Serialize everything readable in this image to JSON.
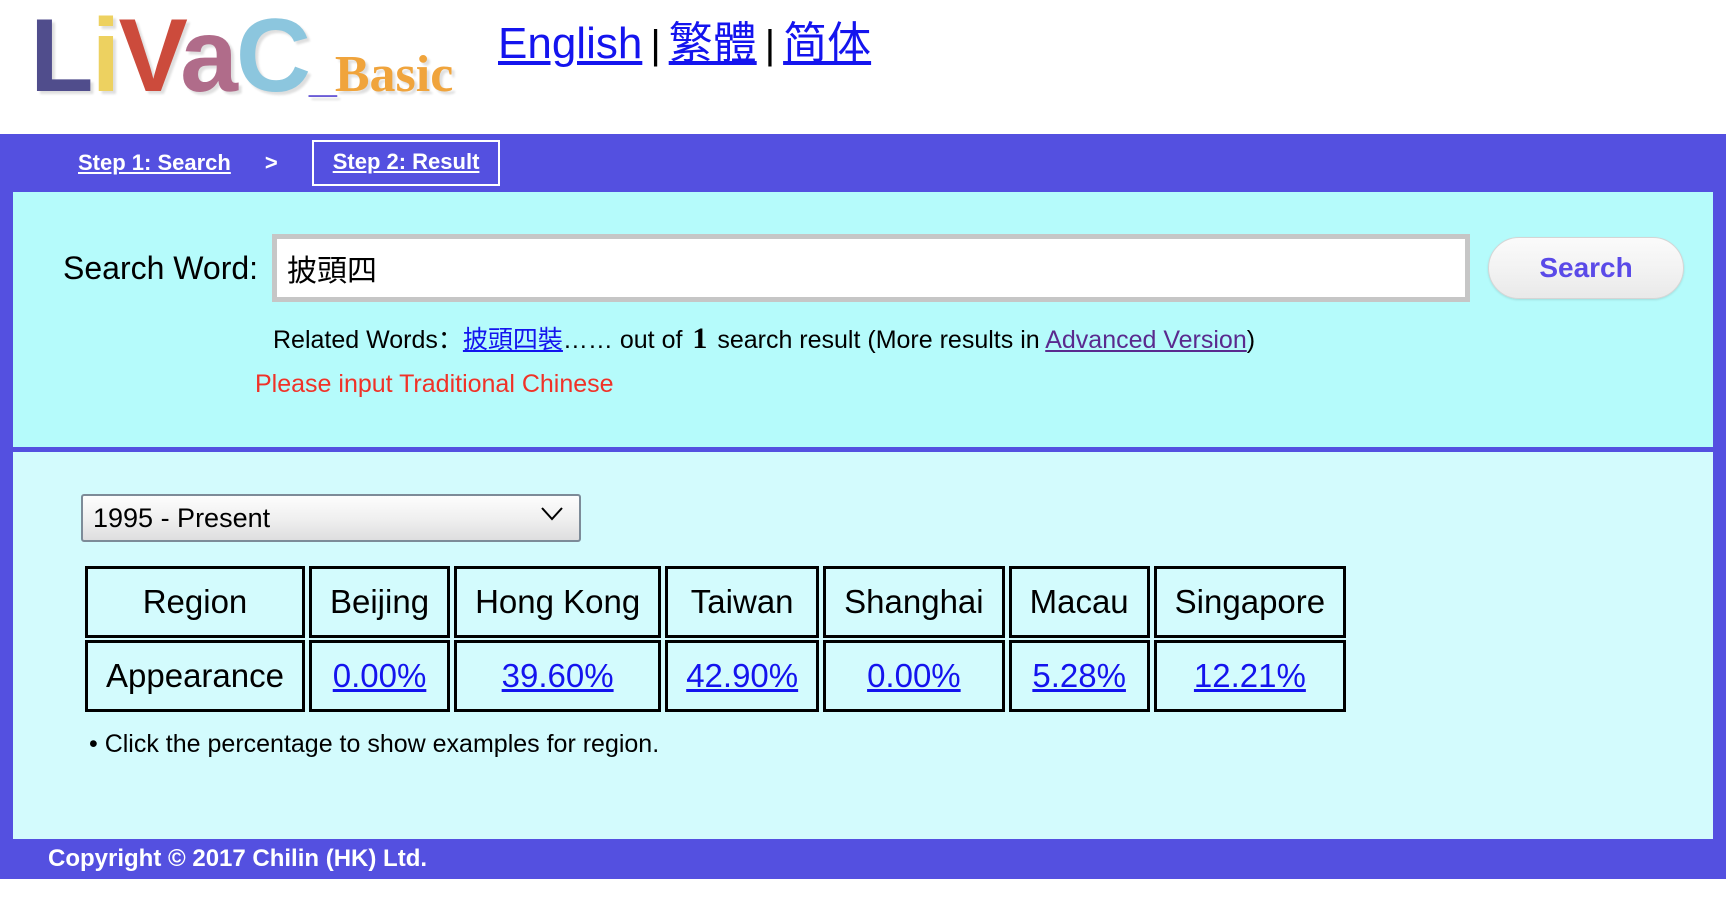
{
  "site": {
    "logo": {
      "part_L": "L",
      "part_i": "i",
      "part_V": "V",
      "part_a": "a",
      "part_C": "C",
      "underscore": "_",
      "basic": "Basic"
    }
  },
  "langnav": {
    "english": "English",
    "separator": "|",
    "traditional": "繁體",
    "simplified": "简体"
  },
  "steps": {
    "step1": "Step 1: Search",
    "arrow": ">",
    "step2": "Step 2: Result"
  },
  "search": {
    "label": "Search Word:",
    "value": "披頭四",
    "placeholder": "",
    "button": "Search",
    "related_prefix": "Related Words：",
    "related_word": "披頭四裝",
    "ellipsis": "……",
    "out_of": " out of ",
    "count": "1",
    "result_text": " search result (More results in ",
    "advanced_link": "Advanced Version",
    "close_paren": ")",
    "warning": "Please input Traditional Chinese"
  },
  "result": {
    "period_selected": "1995 - Present",
    "period_options": [
      "1995 - Present"
    ],
    "footnote": "• Click the percentage to show examples for region.",
    "table": {
      "row_labels": [
        "Region",
        "Appearance"
      ],
      "regions": [
        "Beijing",
        "Hong Kong",
        "Taiwan",
        "Shanghai",
        "Macau",
        "Singapore"
      ],
      "percentages": [
        "0.00%",
        "39.60%",
        "42.90%",
        "0.00%",
        "5.28%",
        "12.21%"
      ]
    }
  },
  "footer": {
    "copyright": "Copyright © 2017 Chilin (HK) Ltd."
  },
  "colors": {
    "brand_blue": "#5450e0",
    "panel_cyan": "#b5fbfb",
    "result_cyan": "#d3fbfd",
    "link_blue": "#1414ee",
    "visited_purple": "#5a2a8e",
    "warning_red": "#f03228"
  }
}
